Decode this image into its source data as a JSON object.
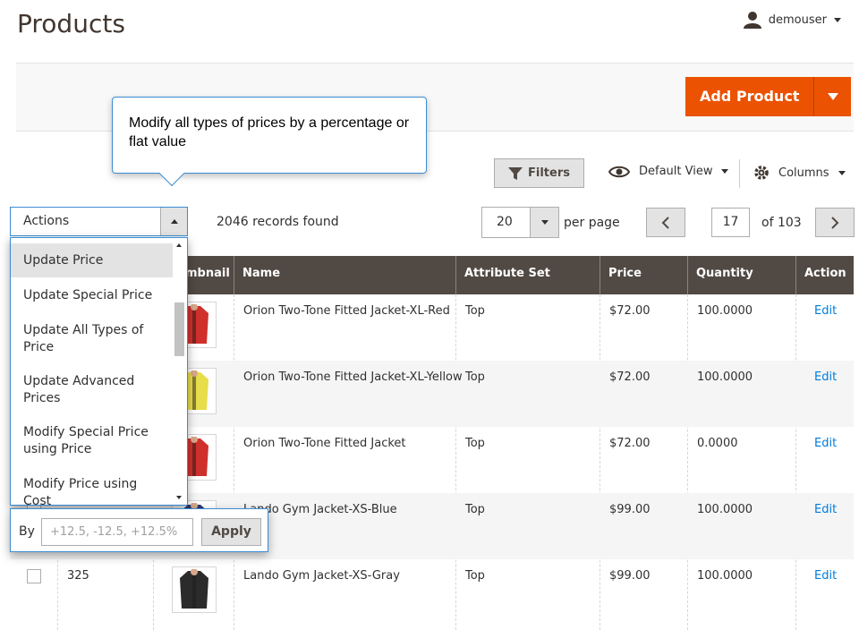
{
  "header": {
    "title": "Products",
    "username": "demouser"
  },
  "toolbar": {
    "add_product_label": "Add Product"
  },
  "tooltip": {
    "text": "Modify all types of prices by a percentage or flat value"
  },
  "controls": {
    "filters_label": "Filters",
    "view_label": "Default View",
    "columns_label": "Columns",
    "actions_label": "Actions",
    "records_text": "2046 records found",
    "per_page_value": "20",
    "per_page_label": "per page",
    "current_page": "17",
    "page_total": "of 103"
  },
  "actions_menu": {
    "items": [
      "Update Price",
      "Update Special Price",
      "Update All Types of Price",
      "Update Advanced Prices",
      "Modify Special Price using Price",
      "Modify Price using Cost"
    ],
    "by_label": "By",
    "input_placeholder": "+12.5, -12.5, +12.5%",
    "apply_label": "Apply"
  },
  "grid": {
    "columns": [
      "Thumbnail",
      "Name",
      "Attribute Set",
      "Price",
      "Quantity",
      "Action"
    ],
    "thumb_header_visible": "mbnail",
    "rows": [
      {
        "id": "",
        "name": "Orion Two-Tone Fitted Jacket-XL-Red",
        "attribute_set": "Top",
        "price": "$72.00",
        "quantity": "100.0000",
        "action": "Edit",
        "thumb_color": "#d0302b"
      },
      {
        "id": "",
        "name": "Orion Two-Tone Fitted Jacket-XL-Yellow",
        "attribute_set": "Top",
        "price": "$72.00",
        "quantity": "100.0000",
        "action": "Edit",
        "thumb_color": "#e8dd4a"
      },
      {
        "id": "",
        "name": "Orion Two-Tone Fitted Jacket",
        "attribute_set": "Top",
        "price": "$72.00",
        "quantity": "0.0000",
        "action": "Edit",
        "thumb_color": "#d0302b"
      },
      {
        "id": "",
        "name": "Lando Gym Jacket-XS-Blue",
        "attribute_set": "Top",
        "price": "$99.00",
        "quantity": "100.0000",
        "action": "Edit",
        "thumb_color": "#2c3b6e"
      },
      {
        "id": "325",
        "name": "Lando Gym Jacket-XS-Gray",
        "attribute_set": "Top",
        "price": "$99.00",
        "quantity": "100.0000",
        "action": "Edit",
        "thumb_color": "#2b2b2b"
      }
    ]
  },
  "colors": {
    "accent": "#eb5202",
    "header_bg": "#514943",
    "link": "#007bdb",
    "focus": "#3c8cd3"
  }
}
